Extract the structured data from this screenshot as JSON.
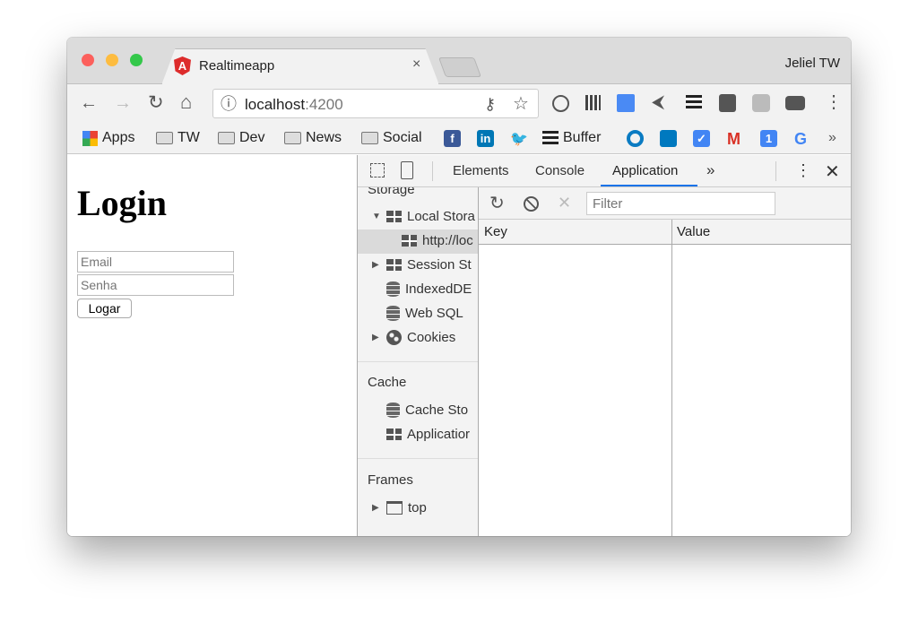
{
  "window": {
    "traffic_colors": [
      "#fc605c",
      "#fdbc40",
      "#34c84a"
    ],
    "user": "Jeliel TW"
  },
  "tab": {
    "title": "Realtimeapp",
    "close": "×",
    "favicon": "A"
  },
  "toolbar": {
    "url_host": "localhost",
    "url_port": ":4200",
    "back": "←",
    "forward": "→",
    "reload": "↻",
    "home": "⌂",
    "info": "ⓘ",
    "key": "⚷",
    "star": "☆",
    "menu": "⋮"
  },
  "bookmarks": {
    "items": [
      "Apps",
      "TW",
      "Dev",
      "News",
      "Social",
      "Buffer"
    ],
    "more": "»"
  },
  "page": {
    "heading": "Login",
    "email_placeholder": "Email",
    "password_placeholder": "Senha",
    "submit": "Logar"
  },
  "devtools": {
    "tabs": [
      "Elements",
      "Console",
      "Application"
    ],
    "active_tab": "Application",
    "more": "»",
    "accent": "#1a73e8",
    "sidebar": {
      "storage": "Storage",
      "local_storage": "Local Stora",
      "local_origin": "http://loc",
      "session_storage": "Session St",
      "indexeddb": "IndexedDE",
      "websql": "Web SQL",
      "cookies": "Cookies",
      "cache": "Cache",
      "cache_storage": "Cache Sto",
      "app_cache": "Applicatior",
      "frames": "Frames",
      "top": "top"
    },
    "filter_placeholder": "Filter",
    "columns": [
      "Key",
      "Value"
    ]
  }
}
